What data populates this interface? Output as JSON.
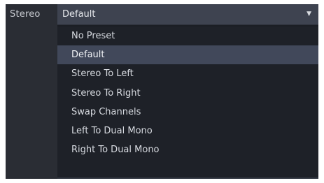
{
  "field": {
    "label": "Stereo",
    "selected_value": "Default",
    "arrow_icon": "triangle-down-icon"
  },
  "menu": {
    "items": [
      {
        "label": "No Preset",
        "selected": false
      },
      {
        "label": "Default",
        "selected": true
      },
      {
        "label": "Stereo To Left",
        "selected": false
      },
      {
        "label": "Stereo To Right",
        "selected": false
      },
      {
        "label": "Swap Channels",
        "selected": false
      },
      {
        "label": "Left To Dual Mono",
        "selected": false
      },
      {
        "label": "Right To Dual Mono",
        "selected": false
      }
    ]
  },
  "colors": {
    "background": "#1b1e24",
    "selected_item": "#41485a",
    "select_box": "#3e4350"
  }
}
